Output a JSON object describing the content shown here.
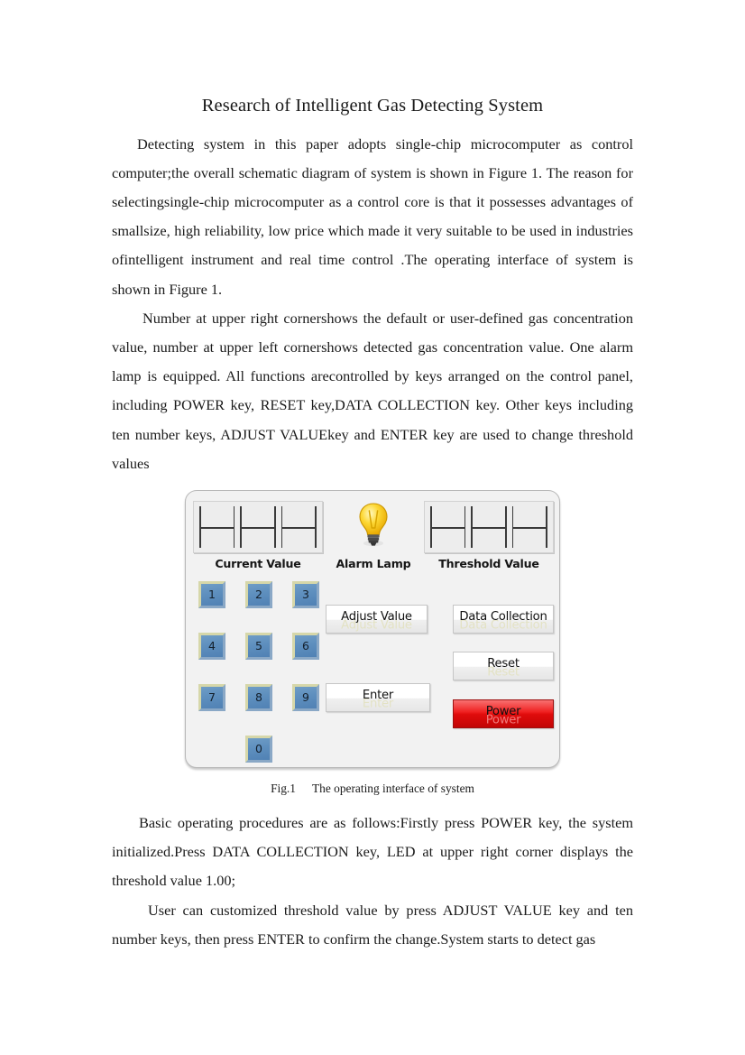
{
  "document": {
    "title": "Research of Intelligent Gas Detecting System",
    "paragraphs": [
      "Detecting system in this paper adopts single-chip microcomputer as control computer;the overall schematic diagram of system is shown in Figure 1. The reason for selectingsingle-chip microcomputer as a control core is that it possesses advantages of smallsize, high reliability, low price which made it very suitable to be used in industries ofintelligent instrument and real time control .The operating interface of system is shown in Figure 1.",
      "Number at upper right cornershows the default or user-defined gas concentration value, number at upper left cornershows detected gas concentration value. One alarm lamp is equipped. All functions arecontrolled by keys arranged on the control panel, including POWER key, RESET key,DATA COLLECTION key. Other keys including ten number keys, ADJUST VALUEkey and ENTER key are used to change threshold values"
    ],
    "paragraphs_after_figure": [
      "Basic operating procedures are as follows:Firstly press POWER key, the system initialized.Press DATA COLLECTION key, LED at upper right corner displays the threshold value 1.00;",
      "User can customized threshold value by press ADJUST VALUE key and ten number keys, then press ENTER to confirm the change.System starts to detect gas"
    ]
  },
  "figure": {
    "caption_number": "Fig.1",
    "caption_text": "The operating interface of system",
    "panel": {
      "displays": [
        {
          "label": "Current Value",
          "digit_count": 3,
          "value": ""
        },
        {
          "label": "Threshold Value",
          "digit_count": 3,
          "value": ""
        }
      ],
      "lamp": {
        "label": "Alarm Lamp",
        "icon": "lightbulb-icon",
        "color": "#f5c316",
        "base_color": "#4a4a4a"
      },
      "number_keys": [
        "1",
        "2",
        "3",
        "4",
        "5",
        "6",
        "7",
        "8",
        "9",
        "0"
      ],
      "buttons": [
        {
          "label": "Adjust Value",
          "name": "adjust-value-button",
          "color": "#ffffff"
        },
        {
          "label": "Data Collection",
          "name": "data-collection-button",
          "color": "#ffffff"
        },
        {
          "label": "Reset",
          "name": "reset-button",
          "color": "#ffffff"
        },
        {
          "label": "Enter",
          "name": "enter-button",
          "color": "#ffffff"
        },
        {
          "label": "Power",
          "name": "power-button",
          "color": "#e00c0c"
        }
      ],
      "colors": {
        "panel_background": "#f2f2f2",
        "key_blue": "#5e8fbe",
        "key_highlight": "#d6d7a9",
        "power_red": "#e00c0c"
      }
    }
  }
}
